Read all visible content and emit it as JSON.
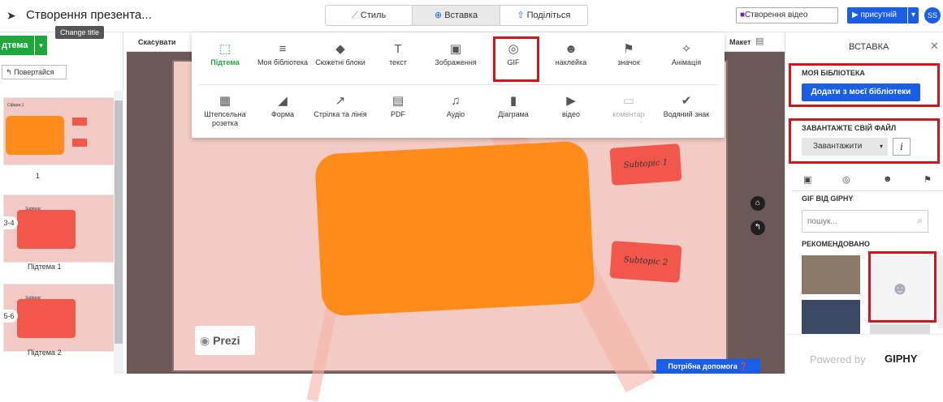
{
  "topbar": {
    "title": "Створення презента...",
    "tooltip": "Change title",
    "tabs": [
      "Стиль",
      "Вставка",
      "Поділіться"
    ],
    "video_btn": "Створення відео",
    "present_btn": "присутній",
    "avatar": "SS"
  },
  "left": {
    "topic_btn": "дтема",
    "back_btn": "Повертайся",
    "slides": [
      {
        "num": "1",
        "label": ""
      },
      {
        "num": "3-4",
        "label": "Підтема 1"
      },
      {
        "num": "5-6",
        "label": "Підтема 2"
      }
    ],
    "thumb_title": "Сфера 1",
    "thumb_sub": "Subtopic"
  },
  "toolbar": {
    "cancel": "Скасувати",
    "layout": "Макет"
  },
  "insert_menu": {
    "row1": [
      {
        "icon": "subtopic-icon",
        "label": "Підтема",
        "glyph": "⬚"
      },
      {
        "icon": "library-icon",
        "label": "Моя бібліотека",
        "glyph": "≡"
      },
      {
        "icon": "story-blocks-icon",
        "label": "Сюжетні блоки",
        "glyph": "◆"
      },
      {
        "icon": "text-icon",
        "label": "текст",
        "glyph": "T"
      },
      {
        "icon": "image-icon",
        "label": "Зображення",
        "glyph": "▣"
      },
      {
        "icon": "gif-icon",
        "label": "GIF",
        "glyph": "◎"
      },
      {
        "icon": "sticker-icon",
        "label": "наклейка",
        "glyph": "☻"
      },
      {
        "icon": "flag-icon",
        "label": "значок",
        "glyph": "⚑"
      },
      {
        "icon": "animation-icon",
        "label": "Анімація",
        "glyph": "✧"
      }
    ],
    "row2": [
      {
        "icon": "stamp-icon",
        "label": "Штепсельна розетка",
        "glyph": "▦"
      },
      {
        "icon": "shape-icon",
        "label": "Форма",
        "glyph": "◢"
      },
      {
        "icon": "arrow-icon",
        "label": "Стрілка та лінія",
        "glyph": "↗"
      },
      {
        "icon": "pdf-icon",
        "label": "PDF",
        "glyph": "▤"
      },
      {
        "icon": "audio-icon",
        "label": "Аудіо",
        "glyph": "♫"
      },
      {
        "icon": "chart-icon",
        "label": "Діаграма",
        "glyph": "▮"
      },
      {
        "icon": "video-icon",
        "label": "відео",
        "glyph": "▶"
      },
      {
        "icon": "comment-icon",
        "label": "коментар",
        "glyph": "▭"
      },
      {
        "icon": "watermark-icon",
        "label": "Водяний знак",
        "glyph": "✔"
      }
    ]
  },
  "canvas": {
    "sub1": "Subtopic 1",
    "sub2": "Subtopic 2",
    "logo": "Prezi",
    "help": "Потрібна допомога"
  },
  "panel": {
    "title": "ВСТАВКА",
    "lib_title": "МОЯ БІБЛІОТЕКА",
    "lib_btn": "Додати з моєї бібліотеки",
    "upload_title": "ЗАВАНТАЖТЕ СВІЙ ФАЙЛ",
    "upload_btn": "Завантажити",
    "info": "i",
    "gif_from": "GIF ВІД GIPHY",
    "search_placeholder": "пошук...",
    "recommended": "РЕКОМЕНДОВАНО",
    "powered": "Powered by",
    "giphy": "GIPHY"
  },
  "colors": {
    "accent": "#1a5ee8",
    "red": "#d0161c",
    "green": "#1ea83b",
    "orange": "#ff8c1a",
    "coral": "#f2574c"
  }
}
